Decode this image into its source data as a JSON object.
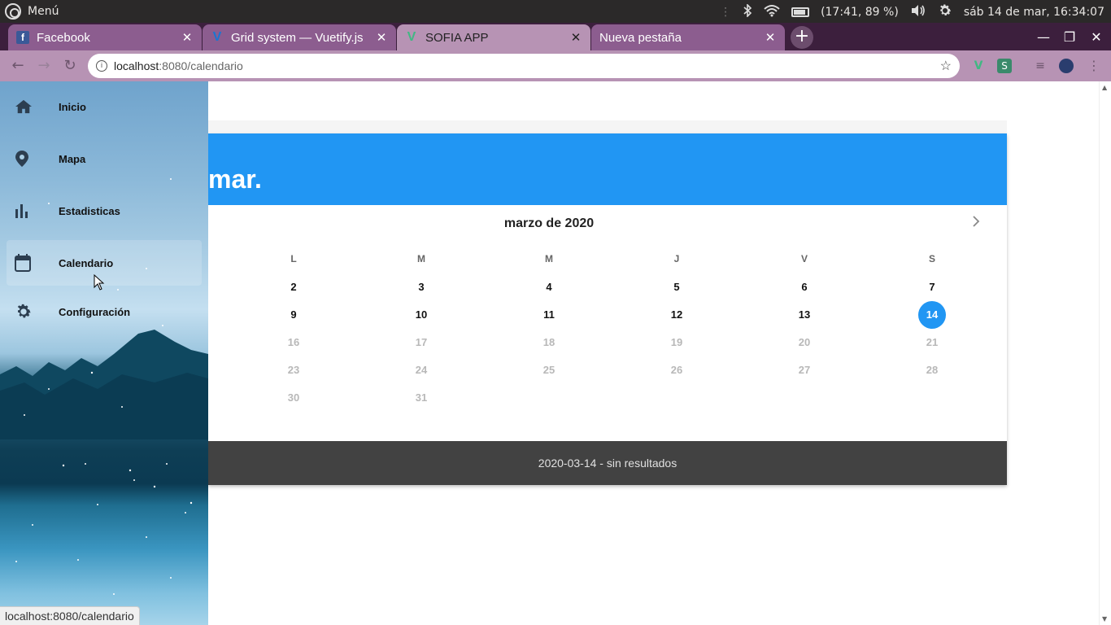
{
  "os": {
    "menu_label": "Menú",
    "battery_text": "(17:41, 89 %)",
    "datetime": "sáb 14 de mar, 16:34:07"
  },
  "browser": {
    "tabs": [
      {
        "title": "Facebook",
        "favicon": "facebook-icon",
        "active": false
      },
      {
        "title": "Grid system — Vuetify.js",
        "favicon": "vuetify-icon",
        "active": false
      },
      {
        "title": "SOFIA APP",
        "favicon": "vue-icon",
        "active": true
      },
      {
        "title": "Nueva pestaña",
        "favicon": "none",
        "active": false
      }
    ],
    "url_host": "localhost",
    "url_path": ":8080/calendario",
    "status_url": "localhost:8080/calendario"
  },
  "drawer": {
    "items": [
      {
        "label": "Inicio",
        "icon": "home-icon"
      },
      {
        "label": "Mapa",
        "icon": "map-pin-icon"
      },
      {
        "label": "Estadisticas",
        "icon": "bar-chart-icon"
      },
      {
        "label": "Calendario",
        "icon": "calendar-icon"
      },
      {
        "label": "Configuración",
        "icon": "gear-icon"
      }
    ],
    "active_index": 3
  },
  "calendar": {
    "header_text": "mar.",
    "month_title": "marzo de 2020",
    "weekdays": [
      "L",
      "M",
      "M",
      "J",
      "V",
      "S"
    ],
    "weeks": [
      [
        "2",
        "3",
        "4",
        "5",
        "6",
        "7"
      ],
      [
        "9",
        "10",
        "11",
        "12",
        "13",
        "14"
      ],
      [
        "16",
        "17",
        "18",
        "19",
        "20",
        "21"
      ],
      [
        "23",
        "24",
        "25",
        "26",
        "27",
        "28"
      ],
      [
        "30",
        "31"
      ]
    ],
    "today": "14",
    "last_enabled_day": 14,
    "footer_text": "2020-03-14 - sin resultados",
    "accent_color": "#2196f3"
  }
}
